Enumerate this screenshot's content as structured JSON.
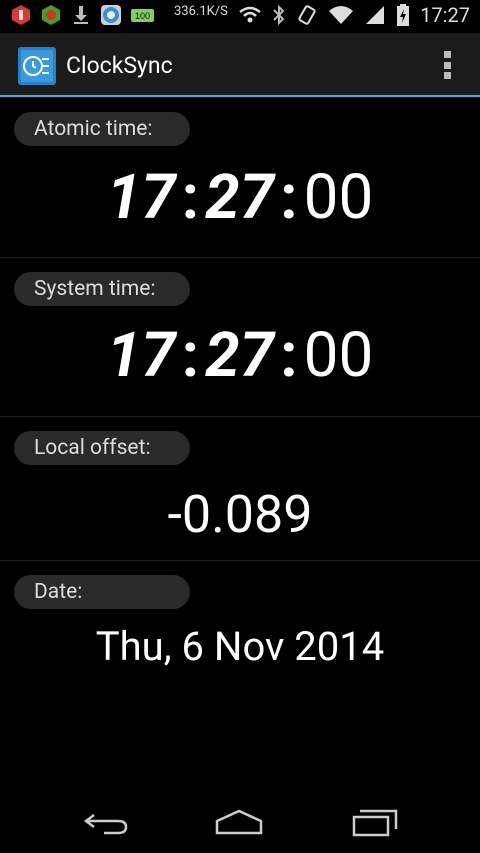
{
  "status_bar": {
    "speed": "336.1K/S",
    "time": "17:27",
    "icons": [
      "shield-icon",
      "bug-icon",
      "download-icon",
      "chrome-icon",
      "battery-100-icon",
      "wifi-icon",
      "bluetooth-icon",
      "rotate-icon",
      "wifi-signal-icon",
      "battery-charging-icon"
    ],
    "battery_badge": "100"
  },
  "action_bar": {
    "title": "ClockSync",
    "accent": "#33b5e5"
  },
  "sections": {
    "atomic": {
      "label": "Atomic time:",
      "hours": "17",
      "minutes": "27",
      "seconds": "00",
      "sep": ":"
    },
    "system": {
      "label": "System time:",
      "hours": "17",
      "minutes": "27",
      "seconds": "00",
      "sep": ":"
    },
    "offset": {
      "label": "Local offset:",
      "value": "-0.089"
    },
    "date": {
      "label": "Date:",
      "value": "Thu, 6 Nov 2014"
    }
  },
  "nav_bar": {
    "icons": [
      "back-icon",
      "home-icon",
      "recents-icon"
    ]
  }
}
